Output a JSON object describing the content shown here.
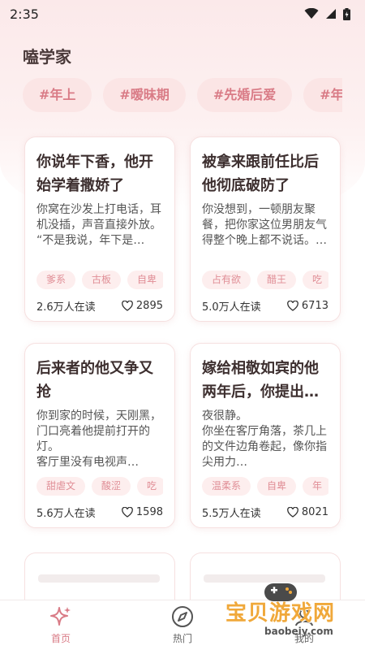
{
  "status_bar": {
    "time": "2:35"
  },
  "app": {
    "title": "嗑学家"
  },
  "tags": [
    "#年上",
    "#暧昧期",
    "#先婚后爱",
    "#年下"
  ],
  "cards": [
    {
      "title": "你说年下香，他开始学着撒娇了",
      "snippet": "你窝在沙发上打电话，耳机没插，声音直接外放。\n“不是我说，年下是…",
      "tags": [
        "爹系",
        "古板",
        "自卑"
      ],
      "readers": "2.6万人在读",
      "likes": "2895"
    },
    {
      "title": "被拿来跟前任比后他彻底破防了",
      "snippet": "你没想到，一顿朋友聚餐，把你家这位男朋友气得整个晚上都不说话。…",
      "tags": [
        "占有欲",
        "醋王",
        "吃"
      ],
      "readers": "5.0万人在读",
      "likes": "6713"
    },
    {
      "title": "后来者的他又争又抢",
      "snippet": "你到家的时候，天刚黑，门口亮着他提前打开的灯。\n客厅里没有电视声…",
      "tags": [
        "甜虐文",
        "酸涩",
        "吃"
      ],
      "readers": "5.6万人在读",
      "likes": "1598"
    },
    {
      "title": "嫁给相敬如宾的他两年后，你提出…",
      "snippet": "夜很静。\n你坐在客厅角落，茶几上的文件边角卷起，像你指尖用力…",
      "tags": [
        "温柔系",
        "自卑",
        "年"
      ],
      "readers": "5.5万人在读",
      "likes": "8021"
    }
  ],
  "bottom_nav": [
    {
      "label": "首页",
      "icon": "sparkle-icon",
      "active": true
    },
    {
      "label": "热门",
      "icon": "compass-icon",
      "active": false
    },
    {
      "label": "我的",
      "icon": "profile-icon",
      "active": false
    }
  ],
  "watermark": {
    "text": "宝贝游戏网",
    "url": "baobeiy.com"
  },
  "colors": {
    "accent": "#d97b86",
    "tag_bg": "#fbe5e5",
    "bg_tint": "#fbe9ea"
  }
}
